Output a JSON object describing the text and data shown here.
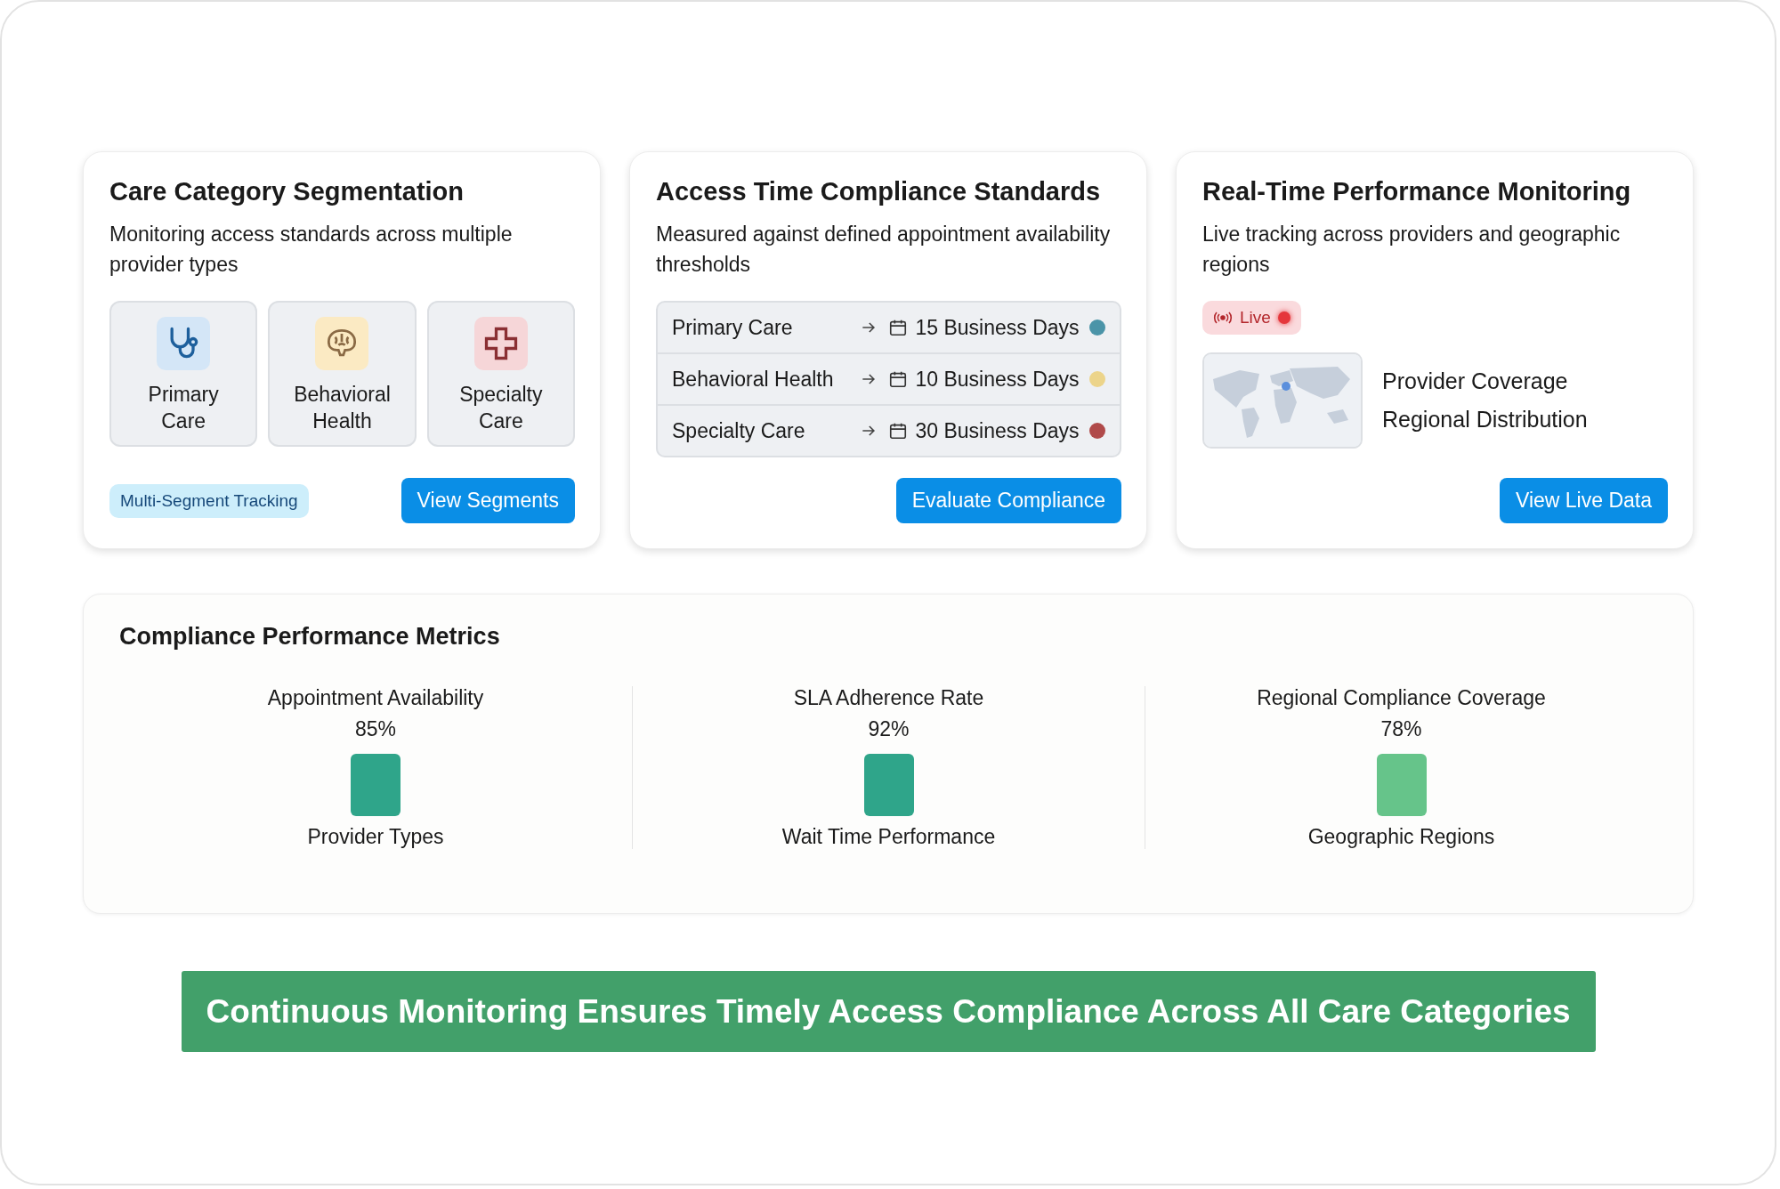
{
  "cards": [
    {
      "kind": "segments",
      "title": "Care Category Segmentation",
      "description": "Monitoring access standards across multiple provider types",
      "segments": [
        {
          "label": "Primary\nCare"
        },
        {
          "label": "Behavioral\nHealth"
        },
        {
          "label": "Specialty\nCare"
        }
      ],
      "tag": "Multi-Segment Tracking",
      "button": "View Segments"
    },
    {
      "kind": "standards",
      "title": "Access Time Compliance Standards",
      "description": "Measured against defined appointment availability thresholds",
      "standards": [
        {
          "category": "Primary Care",
          "days": "15 Business Days",
          "color": "#4b94a8"
        },
        {
          "category": "Behavioral Health",
          "days": "10 Business Days",
          "color": "#ecd48a"
        },
        {
          "category": "Specialty Care",
          "days": "30 Business Days",
          "color": "#b04a4a"
        }
      ],
      "button": "Evaluate Compliance"
    },
    {
      "kind": "monitoring",
      "title": "Real-Time Performance Monitoring",
      "description": "Live tracking across providers and geographic regions",
      "live": "Live",
      "map_lines": [
        "Provider Coverage",
        "Regional Distribution"
      ],
      "button": "View Live Data"
    }
  ],
  "metrics": {
    "title": "Compliance Performance Metrics",
    "items": [
      {
        "label": "Appointment Availability",
        "value": "85%",
        "color": "#2fa58a",
        "caption": "Provider Types"
      },
      {
        "label": "SLA Adherence Rate",
        "value": "92%",
        "color": "#2fa58a",
        "caption": "Wait Time Performance"
      },
      {
        "label": "Regional Compliance Coverage",
        "value": "78%",
        "color": "#66c48a",
        "caption": "Geographic Regions"
      }
    ]
  },
  "banner": "Continuous Monitoring Ensures Timely Access Compliance Across All Care Categories"
}
